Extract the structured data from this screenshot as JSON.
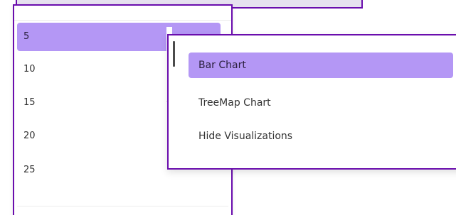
{
  "page_size_menu": {
    "options": [
      {
        "label": "5",
        "selected": true
      },
      {
        "label": "10",
        "selected": false
      },
      {
        "label": "15",
        "selected": false
      },
      {
        "label": "20",
        "selected": false
      },
      {
        "label": "25",
        "selected": false
      }
    ]
  },
  "visualization_menu": {
    "options": [
      {
        "label": "Bar Chart",
        "selected": true
      },
      {
        "label": "TreeMap Chart",
        "selected": false
      },
      {
        "label": "Hide Visualizations",
        "selected": false
      }
    ]
  },
  "colors": {
    "selected_bg": "#b497f5",
    "focus_border": "#6a0dad",
    "top_strip_bg": "#e6e1ef"
  }
}
